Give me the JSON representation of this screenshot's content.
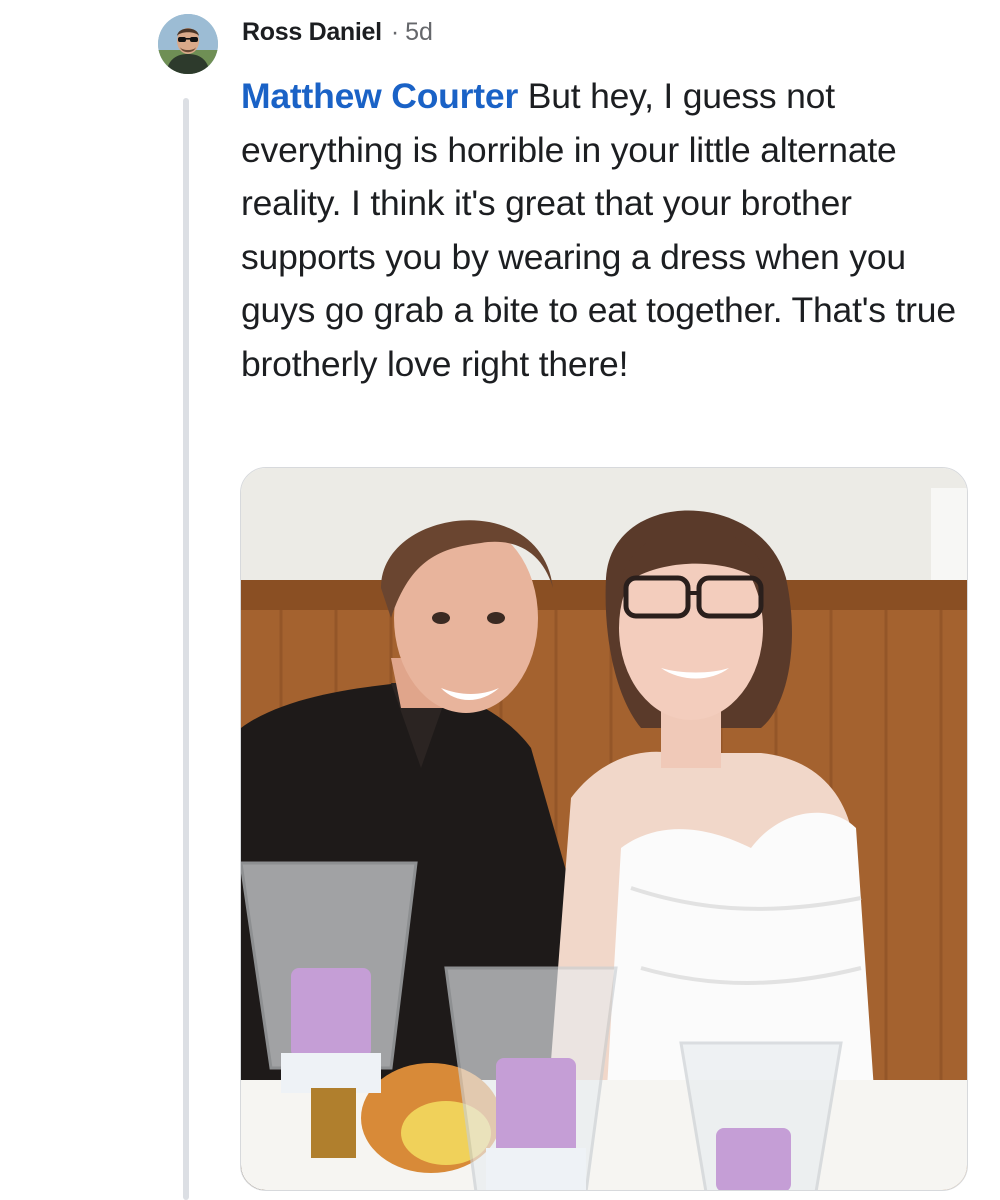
{
  "comment": {
    "author_name": "Ross Daniel",
    "separator": "·",
    "timestamp": "5d",
    "mention": "Matthew Courter",
    "body_text": " But hey, I guess not everything is horrible in your little alternate reality. I think it's great that your brother supports you by wearing a dress when you guys go grab a bite to eat together. That's true brotherly love right there!"
  },
  "icons": {
    "avatar": "profile-photo",
    "photo": "attached-photo"
  },
  "colors": {
    "mention": "#1a62c6",
    "author": "#1c1e21",
    "meta": "#65676b",
    "thread_line": "#dcdfe4"
  }
}
